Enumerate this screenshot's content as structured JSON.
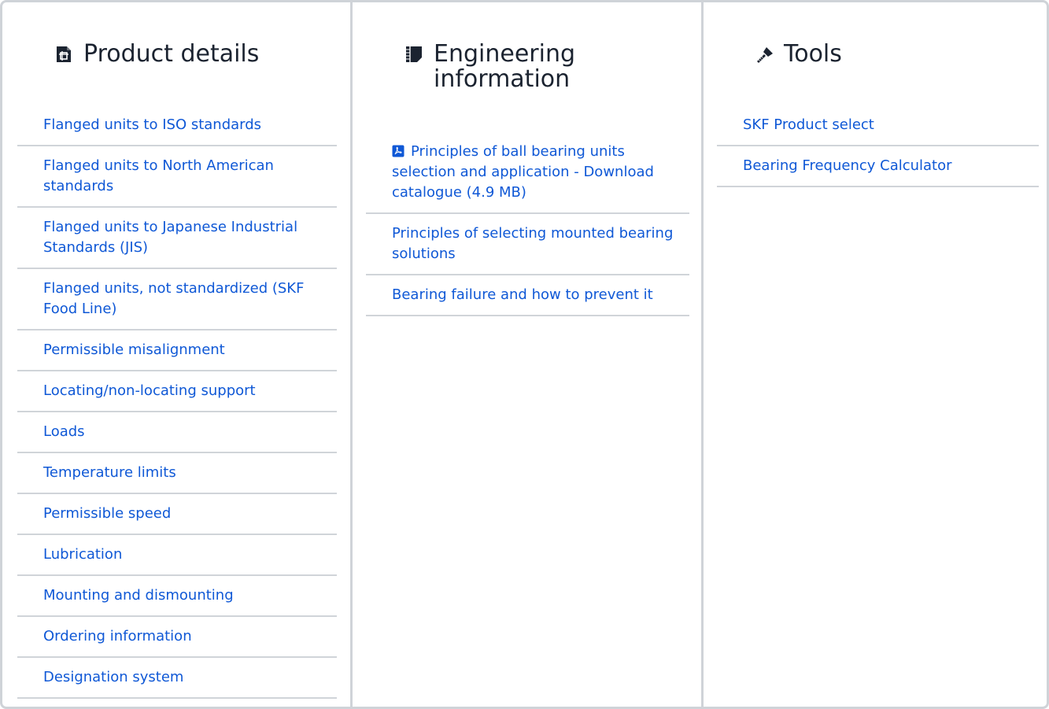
{
  "columns": [
    {
      "title": "Product details",
      "icon": "document-grid-icon",
      "items": [
        "Flanged units to ISO standards",
        "Flanged units to North American standards",
        "Flanged units to Japanese Industrial Standards (JIS)",
        "Flanged units, not standardized (SKF Food Line)",
        "Permissible misalignment",
        "Locating/non-locating support",
        "Loads",
        "Temperature limits",
        "Permissible speed",
        "Lubrication",
        "Mounting and dismounting",
        "Ordering information",
        "Designation system"
      ]
    },
    {
      "title": "Engineering information",
      "icon": "ruled-notebook-icon",
      "items": [
        {
          "label": "Principles of ball bearing units selection and application - Download catalogue (4.9 MB)",
          "icon": "pdf-icon"
        },
        {
          "label": "Principles of selecting mounted bearing solutions"
        },
        {
          "label": "Bearing failure and how to prevent it"
        }
      ]
    },
    {
      "title": "Tools",
      "icon": "hammer-ruler-icon",
      "items": [
        "SKF Product select",
        "Bearing Frequency Calculator"
      ]
    }
  ],
  "colors": {
    "link": "#0f58d6",
    "divider": "#d0d4d9",
    "border": "#cfd3d8",
    "heading": "#1b2330"
  }
}
